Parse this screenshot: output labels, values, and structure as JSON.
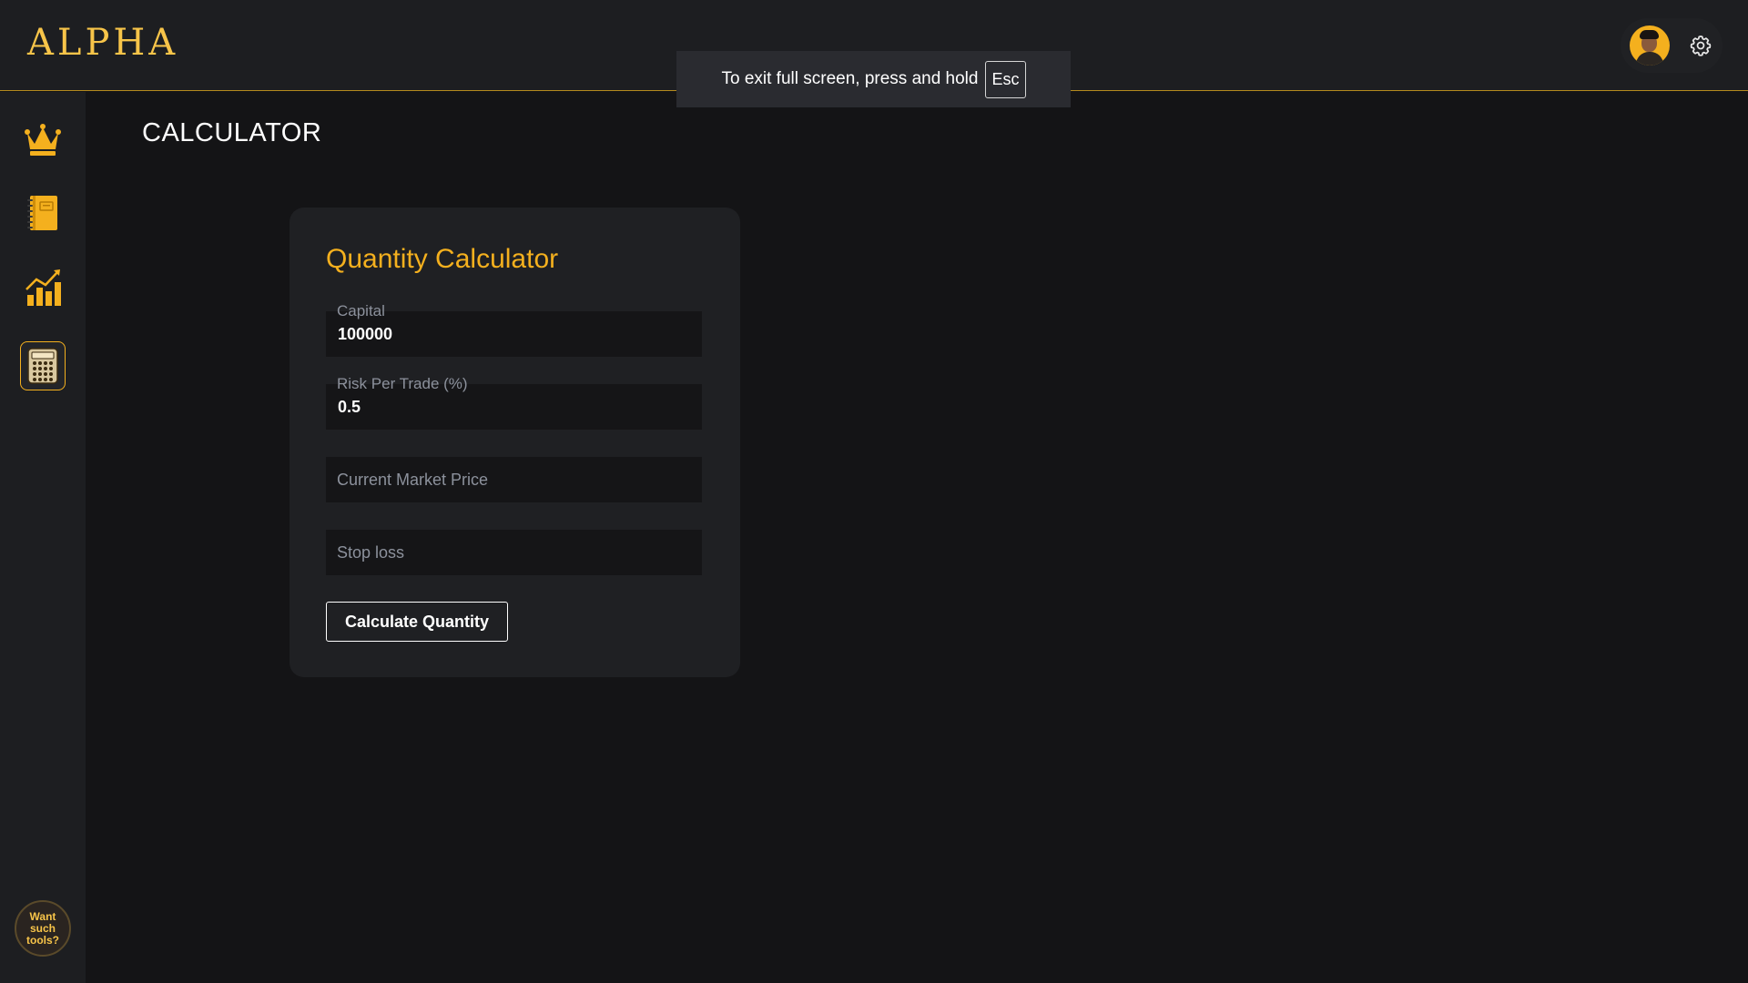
{
  "app": {
    "brand": "ALPHA"
  },
  "fullscreen_notice": {
    "text": "To exit full screen, press and hold",
    "key": "Esc"
  },
  "sidebar": {
    "items": [
      {
        "icon": "crown-icon",
        "active": false
      },
      {
        "icon": "journal-icon",
        "active": false
      },
      {
        "icon": "chart-growth-icon",
        "active": false
      },
      {
        "icon": "calculator-icon",
        "active": true
      }
    ],
    "promo_label": "Want such tools?"
  },
  "page": {
    "title": "CALCULATOR"
  },
  "calculator": {
    "title": "Quantity Calculator",
    "capital": {
      "label": "Capital",
      "value": "100000"
    },
    "risk": {
      "label": "Risk Per Trade (%)",
      "value": "0.5"
    },
    "cmp": {
      "placeholder": "Current Market Price",
      "value": ""
    },
    "stop_loss": {
      "placeholder": "Stop loss",
      "value": ""
    },
    "button_label": "Calculate Quantity"
  },
  "colors": {
    "accent": "#f4b01e",
    "background": "#141416",
    "panel": "#1d1e21",
    "card": "#1f2023",
    "input_bg": "#151517",
    "muted_text": "#8c919c"
  }
}
